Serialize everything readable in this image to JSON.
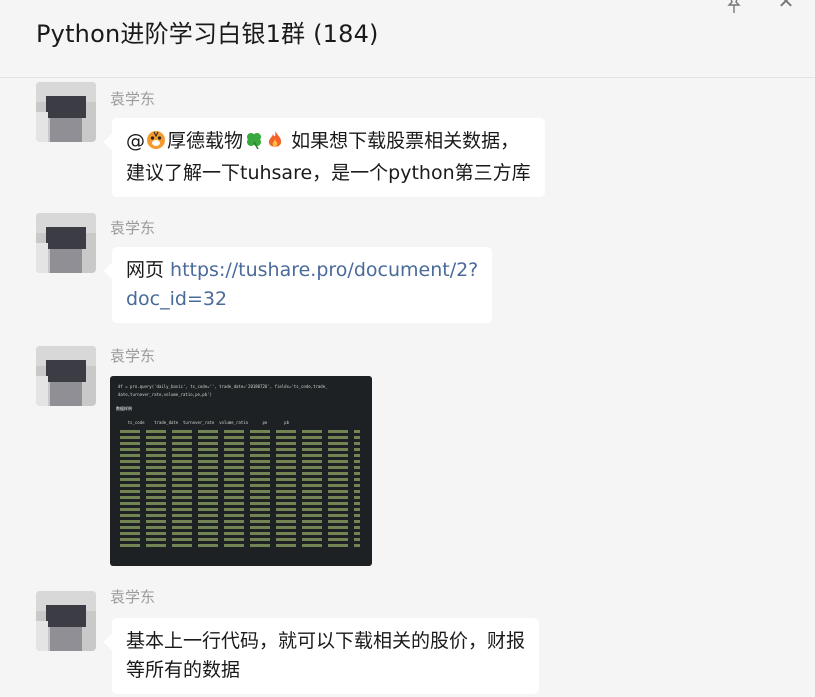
{
  "header": {
    "title": "Python进阶学习白银1群 (184)"
  },
  "icons": {
    "pin": "pin-icon",
    "close": "close-icon"
  },
  "messages": [
    {
      "sender": "袁学东",
      "parts": {
        "at": "@",
        "name": "厚德载物",
        "text1": "如果想下载股票相关数据，",
        "text2": "建议了解一下tuhsare，是一个python第三方库"
      }
    },
    {
      "sender": "袁学东",
      "parts": {
        "prefix": "网页 ",
        "link1": "https://tushare.pro/document/2?",
        "link2": "doc_id=32"
      }
    },
    {
      "sender": "袁学东",
      "image": {
        "code_line1": "df = pro.query('daily_basic', ts_code='', trade_date='20180726', fields='ts_code,trade_",
        "code_line2": "date,turnover_rate,volume_ratio,pe,pb')",
        "section_label": "数据样例",
        "table_header": "    ts_code    trade_date  turnover_rate  volume_ratio      pe       pb"
      }
    },
    {
      "sender": "袁学东",
      "parts": {
        "line1": "基本上一行代码，就可以下载相关的股价，财报",
        "line2": "等所有的数据"
      }
    }
  ]
}
